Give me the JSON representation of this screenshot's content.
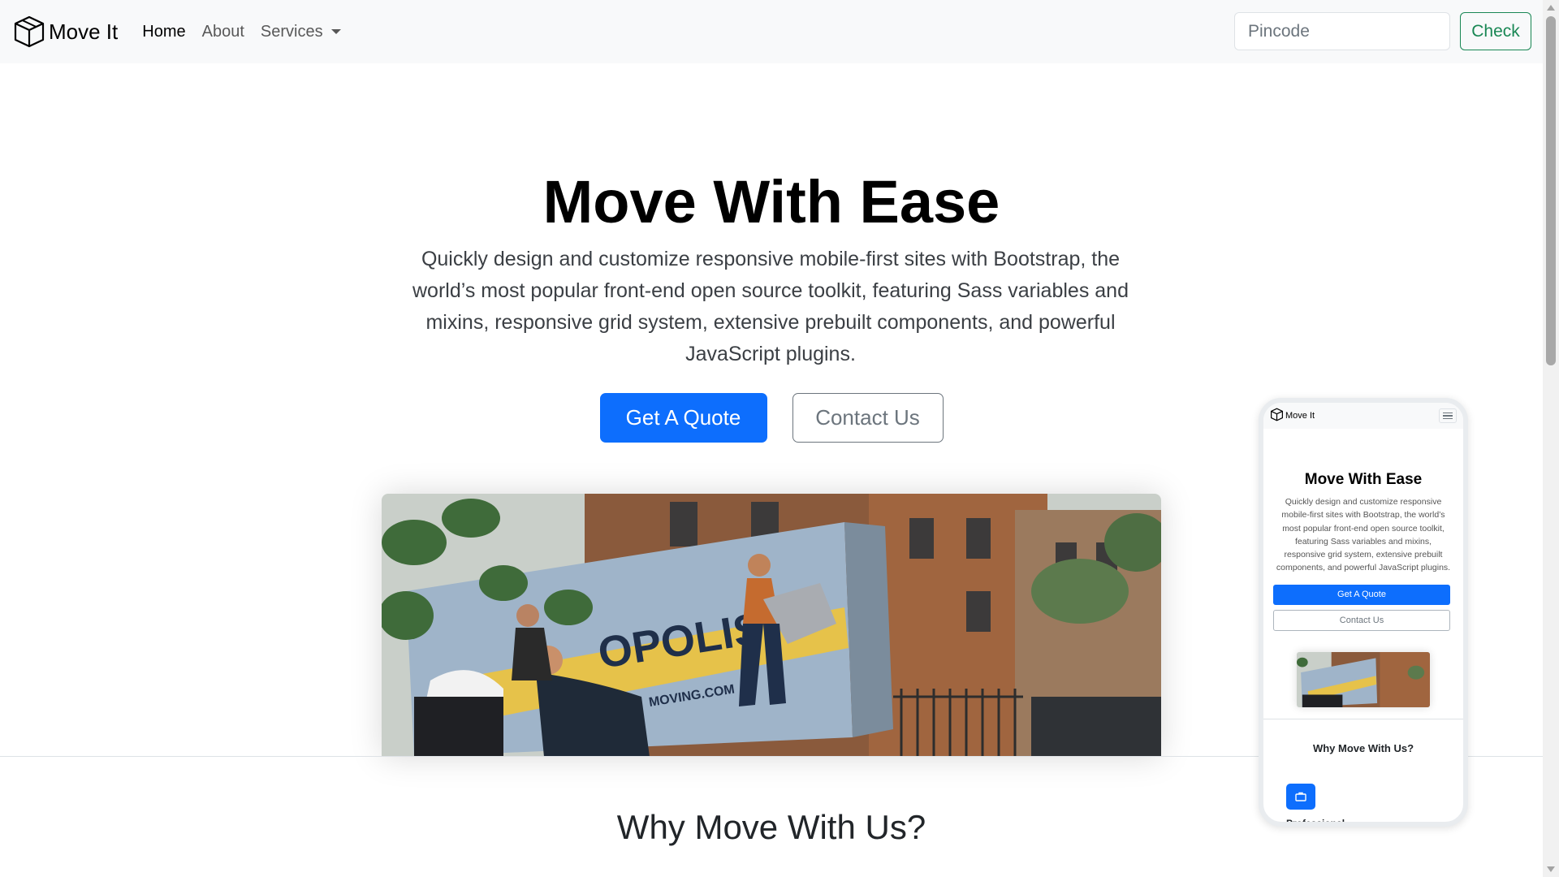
{
  "navbar": {
    "brand": "Move It",
    "links": [
      {
        "label": "Home"
      },
      {
        "label": "About"
      }
    ],
    "services_label": "Services",
    "pincode_placeholder": "Pincode",
    "check_label": "Check"
  },
  "hero": {
    "title": "Move With Ease",
    "lead": "Quickly design and customize responsive mobile-first sites with Bootstrap, the world’s most popular front-end open source toolkit, featuring Sass variables and mixins, responsive grid system, extensive prebuilt components, and powerful JavaScript plugins.",
    "primary_button": "Get A Quote",
    "secondary_button": "Contact Us",
    "image_truck_text": "OPOLIS",
    "image_truck_url": "MOVING.COM"
  },
  "section": {
    "why_title": "Why Move With Us?"
  },
  "phone_preview": {
    "brand": "Move It",
    "title": "Move With Ease",
    "lead": "Quickly design and customize responsive mobile-first sites with Bootstrap, the world’s most popular front-end open source toolkit, featuring Sass variables and mixins, responsive grid system, extensive prebuilt components, and powerful JavaScript plugins.",
    "primary_button": "Get A Quote",
    "secondary_button": "Contact Us",
    "why_title": "Why Move With Us?",
    "feature_label": "Professional"
  },
  "colors": {
    "primary": "#0d6efd",
    "success": "#198754",
    "secondary": "#6c757d",
    "navbar_bg": "#f8f9fa"
  },
  "icons": {
    "brand": "box-icon",
    "services": "chevron-down-icon",
    "menu": "hamburger-icon",
    "feature": "briefcase-icon"
  }
}
